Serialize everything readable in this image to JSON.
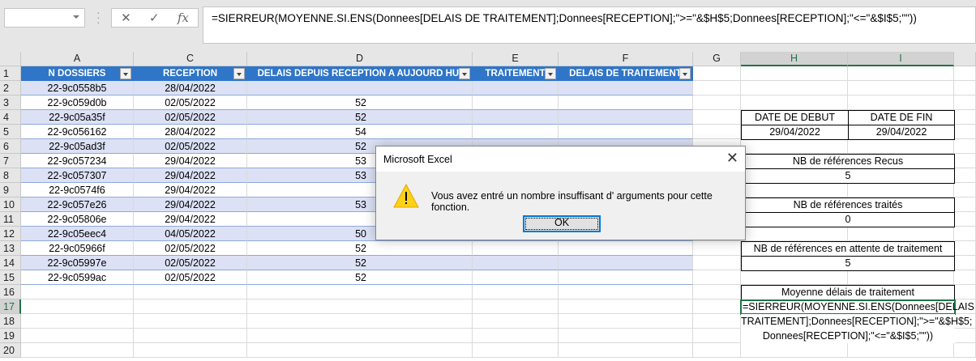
{
  "formula_bar": {
    "name_box": "",
    "cancel_icon": "✕",
    "enter_icon": "✓",
    "fx_label": "fx",
    "formula": "=SIERREUR(MOYENNE.SI.ENS(Donnees[DELAIS DE TRAITEMENT];Donnees[RECEPTION];\">=\"&$H$5;Donnees[RECEPTION];\"<=\"&$I$5;\"\"))"
  },
  "columns": [
    "A",
    "C",
    "D",
    "E",
    "F",
    "G",
    "H",
    "I"
  ],
  "table": {
    "headers": [
      "N DOSSIERS",
      "RECEPTION",
      "DELAIS DEPUIS RECEPTION A AUJOURD HUI",
      "TRAITEMENT",
      "DELAIS DE TRAITEMENT"
    ],
    "rows": [
      [
        "22-9c0558b5",
        "28/04/2022",
        ""
      ],
      [
        "22-9c059d0b",
        "02/05/2022",
        "52"
      ],
      [
        "22-9c05a35f",
        "02/05/2022",
        "52"
      ],
      [
        "22-9c056162",
        "28/04/2022",
        "54"
      ],
      [
        "22-9c05ad3f",
        "02/05/2022",
        "52"
      ],
      [
        "22-9c057234",
        "29/04/2022",
        "53"
      ],
      [
        "22-9c057307",
        "29/04/2022",
        "53"
      ],
      [
        "22-9c0574f6",
        "29/04/2022",
        ""
      ],
      [
        "22-9c057e26",
        "29/04/2022",
        "53"
      ],
      [
        "22-9c05806e",
        "29/04/2022",
        ""
      ],
      [
        "22-9c05eec4",
        "04/05/2022",
        "50"
      ],
      [
        "22-9c05966f",
        "02/05/2022",
        "52"
      ],
      [
        "22-9c05997e",
        "02/05/2022",
        "52"
      ],
      [
        "22-9c0599ac",
        "02/05/2022",
        "52"
      ]
    ]
  },
  "summary": {
    "date_debut_label": "DATE DE DEBUT",
    "date_fin_label": "DATE DE FIN",
    "date_debut": "29/04/2022",
    "date_fin": "29/04/2022",
    "recus_label": "NB de références Recus",
    "recus": "5",
    "traites_label": "NB de références traités",
    "traites": "0",
    "attente_label": "NB de références en attente de traitement",
    "attente": "5",
    "moyenne_label": "Moyenne délais de traitement",
    "editing_line1": "=SIERREUR(MOYENNE.SI.ENS(Donnees[DELAIS DE",
    "editing_line2": "TRAITEMENT];Donnees[RECEPTION];\">=\"&$H$5;",
    "editing_line3": "Donnees[RECEPTION];\"<=\"&$I$5;\"\"))"
  },
  "dialog": {
    "title": "Microsoft Excel",
    "message": "Vous avez entré un nombre insuffisant d' arguments pour cette fonction.",
    "ok": "OK",
    "close": "✕"
  }
}
